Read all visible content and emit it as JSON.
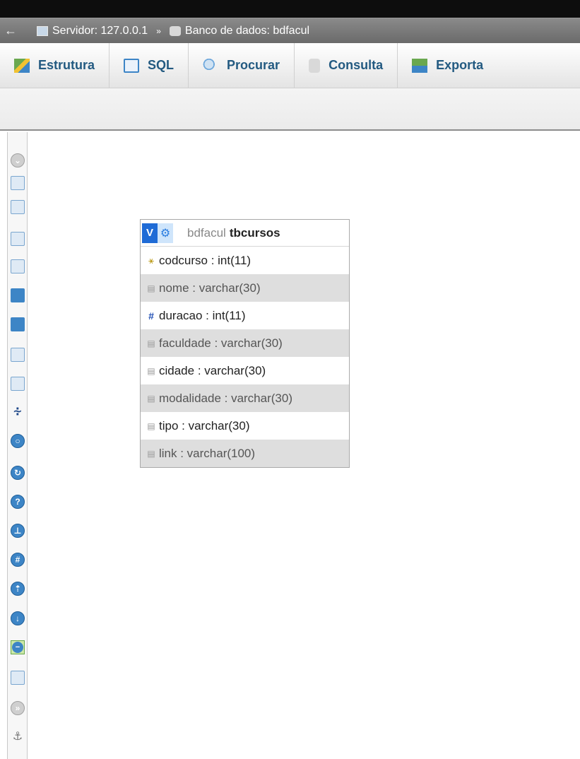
{
  "breadcrumb": {
    "back_arrow": "←",
    "server": "Servidor: 127.0.0.1",
    "separator": "»",
    "database": "Banco de dados: bdfacul"
  },
  "tabs": [
    {
      "label": "Estrutura",
      "icon": "structure-icon"
    },
    {
      "label": "SQL",
      "icon": "sql-icon"
    },
    {
      "label": "Procurar",
      "icon": "search-icon"
    },
    {
      "label": "Consulta",
      "icon": "query-icon"
    },
    {
      "label": "Exporta",
      "icon": "export-icon"
    }
  ],
  "designer": {
    "table": {
      "toggle": "V",
      "gear": "⚙",
      "db_name": "bdfacul",
      "table_name": "tbcursos",
      "columns": [
        {
          "name": "codcurso : int(11)",
          "icon": "primary-key-icon"
        },
        {
          "name": "nome : varchar(30)",
          "icon": "column-icon"
        },
        {
          "name": "duracao : int(11)",
          "icon": "numeric-icon"
        },
        {
          "name": "faculdade : varchar(30)",
          "icon": "column-icon"
        },
        {
          "name": "cidade : varchar(30)",
          "icon": "column-icon"
        },
        {
          "name": "modalidade : varchar(30)",
          "icon": "column-icon"
        },
        {
          "name": "tipo : varchar(30)",
          "icon": "column-icon"
        },
        {
          "name": "link : varchar(100)",
          "icon": "column-icon"
        }
      ]
    }
  },
  "toolbar_icons": [
    "show-hide-menu-icon",
    "fullscreen-icon",
    "add-tables-icon",
    "new-page-icon",
    "open-page-icon",
    "save-page-icon",
    "save-as-icon",
    "delete-page-icon",
    "create-pdf-icon",
    "build-relation-icon",
    "reload-icon",
    "help-icon",
    "angular-links-icon",
    "snap-to-grid-icon",
    "small-big-all-icon",
    "toggle-small-big-icon",
    "toggle-relation-lines-icon",
    "export-schema-icon",
    "move-menu-icon",
    "pin-text-icon"
  ]
}
